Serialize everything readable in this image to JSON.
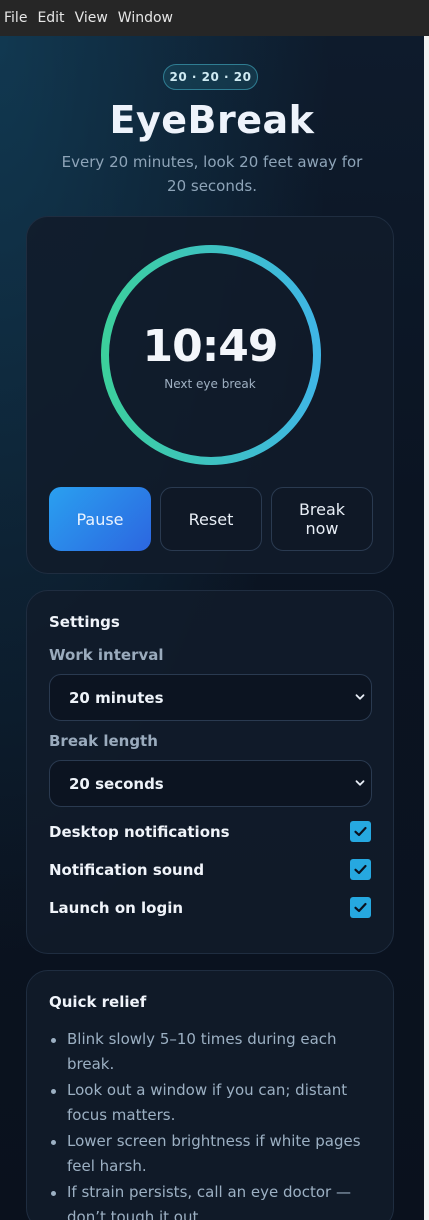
{
  "menubar": {
    "items": [
      "File",
      "Edit",
      "View",
      "Window"
    ]
  },
  "header": {
    "badge": "20 · 20 · 20",
    "title": "EyeBreak",
    "subtitle": "Every 20 minutes, look 20 feet away for 20 seconds."
  },
  "timer": {
    "time": "10:49",
    "caption": "Next eye break",
    "progress": 1.0,
    "ring_colors": [
      "#3ccf9c",
      "#3fb6e6"
    ],
    "buttons": {
      "pause": "Pause",
      "reset": "Reset",
      "break_now": "Break now"
    }
  },
  "settings": {
    "title": "Settings",
    "work_interval": {
      "label": "Work interval",
      "value": "20 minutes"
    },
    "break_length": {
      "label": "Break length",
      "value": "20 seconds"
    },
    "toggles": [
      {
        "label": "Desktop notifications",
        "checked": true
      },
      {
        "label": "Notification sound",
        "checked": true
      },
      {
        "label": "Launch on login",
        "checked": true
      }
    ]
  },
  "relief": {
    "title": "Quick relief",
    "tips": [
      "Blink slowly 5–10 times during each break.",
      "Look out a window if you can; distant focus matters.",
      "Lower screen brightness if white pages feel harsh.",
      "If strain persists, call an eye doctor — don’t tough it out."
    ]
  },
  "colors": {
    "accent": "#26a8e0",
    "primary_button": "#2a8fe8",
    "background": "#0b1220"
  }
}
